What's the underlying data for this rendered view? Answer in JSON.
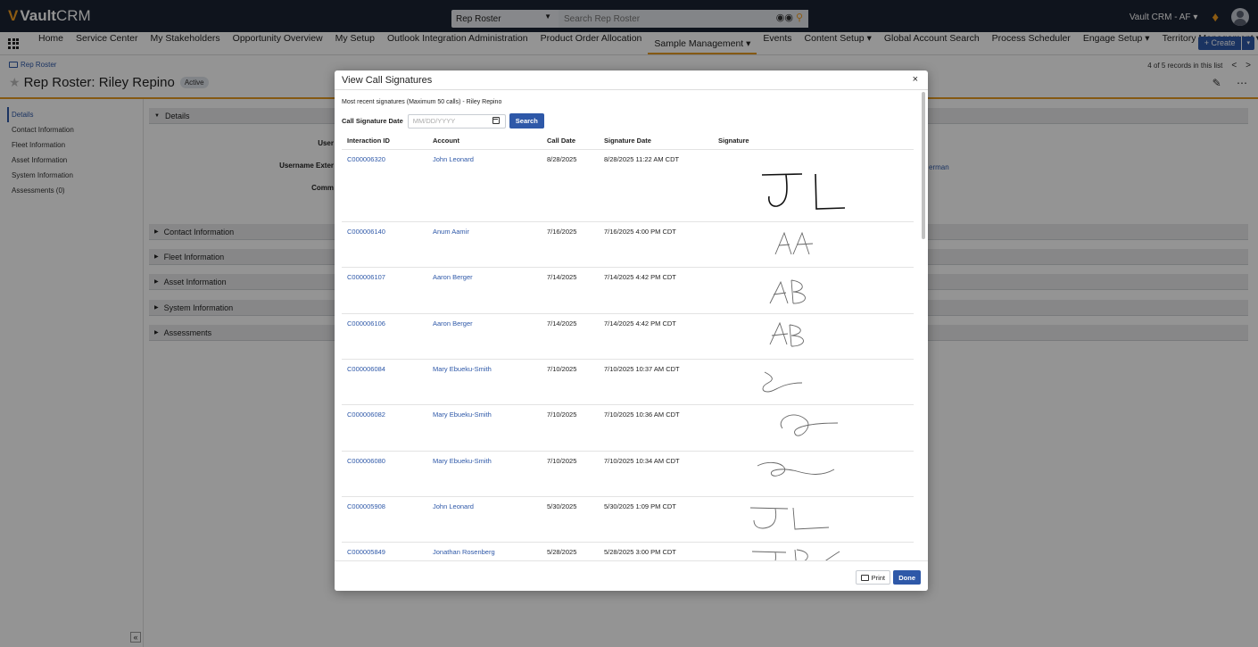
{
  "app": {
    "logo_v": "V",
    "logo_bold": "Vault",
    "logo_light": "CRM"
  },
  "search": {
    "scope": "Rep Roster",
    "placeholder": "Search Rep Roster"
  },
  "user": {
    "label": "Vault CRM - AF ▾"
  },
  "nav": {
    "items": [
      {
        "label": "Home"
      },
      {
        "label": "Service Center"
      },
      {
        "label": "My Stakeholders"
      },
      {
        "label": "Opportunity Overview"
      },
      {
        "label": "My Setup"
      },
      {
        "label": "Outlook Integration Administration"
      },
      {
        "label": "Product Order Allocation"
      },
      {
        "label": "Sample Management ▾",
        "active": true
      },
      {
        "label": "Events"
      },
      {
        "label": "Content Setup ▾"
      },
      {
        "label": "Global Account Search"
      },
      {
        "label": "Process Scheduler"
      },
      {
        "label": "Engage Setup ▾"
      },
      {
        "label": "Territory Management ▾"
      }
    ],
    "more": "≫",
    "create_label": "+ Create",
    "create_dd": "▾"
  },
  "page": {
    "breadcrumb": "Rep Roster",
    "title": "Rep Roster: Riley Repino",
    "status": "Active",
    "records_info": "4 of 5 records in this list",
    "prev": "<",
    "next": ">"
  },
  "sidebar": {
    "items": [
      {
        "label": "Details"
      },
      {
        "label": "Contact Information"
      },
      {
        "label": "Fleet Information"
      },
      {
        "label": "Asset Information"
      },
      {
        "label": "System Information"
      },
      {
        "label": "Assessments (0)"
      }
    ],
    "collapse": "«"
  },
  "sections": {
    "details": "Details",
    "contact": "Contact Information",
    "fleet": "Fleet Information",
    "asset": "Asset Information",
    "system": "System Information",
    "assessments": "Assessments",
    "field_user": "User",
    "field_username_ext": "Username Exter",
    "field_comm": "Comm",
    "side_link": "erman"
  },
  "modal": {
    "title": "View Call Signatures",
    "close": "×",
    "subtitle": "Most recent signatures (Maximum 50 calls) - Riley Repino",
    "filter_label": "Call Signature Date",
    "date_placeholder": "MM/DD/YYYY",
    "search_label": "Search",
    "columns": [
      "Interaction ID",
      "Account",
      "Call Date",
      "Signature Date",
      "Signature"
    ],
    "rows": [
      {
        "id": "C000006320",
        "account": "John Leonard",
        "call_date": "8/28/2025",
        "sig_date": "8/28/2025 11:22 AM CDT",
        "signature": "JL"
      },
      {
        "id": "C000006140",
        "account": "Anum Aamir",
        "call_date": "7/16/2025",
        "sig_date": "7/16/2025 4:00 PM CDT",
        "signature": "AA"
      },
      {
        "id": "C000006107",
        "account": "Aaron Berger",
        "call_date": "7/14/2025",
        "sig_date": "7/14/2025 4:42 PM CDT",
        "signature": "AB"
      },
      {
        "id": "C000006106",
        "account": "Aaron Berger",
        "call_date": "7/14/2025",
        "sig_date": "7/14/2025 4:42 PM CDT",
        "signature": "AB"
      },
      {
        "id": "C000006084",
        "account": "Mary Ebueku-Smith",
        "call_date": "7/10/2025",
        "sig_date": "7/10/2025 10:37 AM CDT",
        "signature": "scribble"
      },
      {
        "id": "C000006082",
        "account": "Mary Ebueku-Smith",
        "call_date": "7/10/2025",
        "sig_date": "7/10/2025 10:36 AM CDT",
        "signature": "scribble"
      },
      {
        "id": "C000006080",
        "account": "Mary Ebueku-Smith",
        "call_date": "7/10/2025",
        "sig_date": "7/10/2025 10:34 AM CDT",
        "signature": "scribble"
      },
      {
        "id": "C000005908",
        "account": "John Leonard",
        "call_date": "5/30/2025",
        "sig_date": "5/30/2025 1:09 PM CDT",
        "signature": "JL"
      },
      {
        "id": "C000005849",
        "account": "Jonathan Rosenberg",
        "call_date": "5/28/2025",
        "sig_date": "5/28/2025 3:00 PM CDT",
        "signature": "JR"
      }
    ],
    "print_label": "Print",
    "done_label": "Done"
  }
}
